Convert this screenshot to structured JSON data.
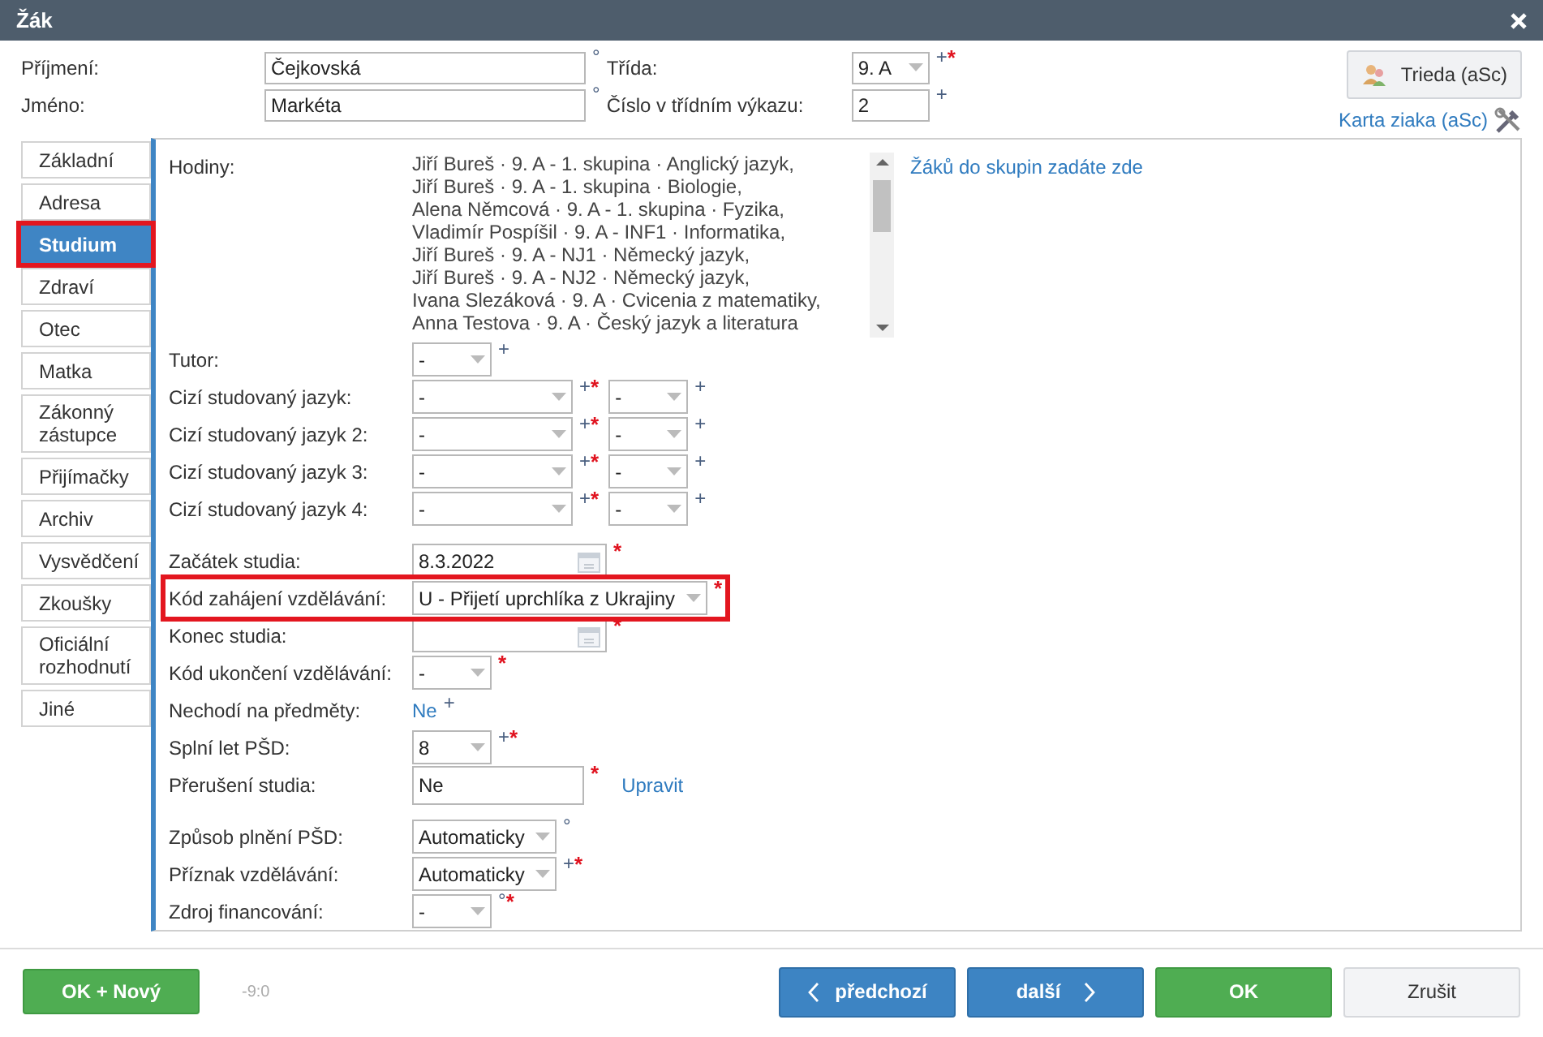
{
  "window": {
    "title": "Žák"
  },
  "header": {
    "fields": [
      {
        "label": "Příjmení:",
        "value": "Čejkovská",
        "marks": [
          {
            "text": "°",
            "kind": "hint"
          }
        ]
      },
      {
        "label": "Jméno:",
        "value": "Markéta",
        "marks": [
          {
            "text": "°",
            "kind": "hint"
          }
        ]
      }
    ],
    "class_fields": [
      {
        "label": "Třída:",
        "kind": "select",
        "value": "9. A",
        "marks": [
          {
            "text": "+",
            "kind": "hint"
          },
          {
            "text": "*",
            "kind": "required"
          }
        ]
      },
      {
        "label": "Číslo v třídním výkazu:",
        "kind": "text",
        "value": "2",
        "marks": [
          {
            "text": "+",
            "kind": "hint"
          }
        ]
      }
    ],
    "class_button": "Trieda (aSc)",
    "card_link": "Karta ziaka (aSc)"
  },
  "tabs": [
    {
      "label": "Základní",
      "selected": false,
      "highlighted": false
    },
    {
      "label": "Adresa",
      "selected": false,
      "highlighted": false
    },
    {
      "label": "Studium",
      "selected": true,
      "highlighted": true
    },
    {
      "label": "Zdraví",
      "selected": false,
      "highlighted": false
    },
    {
      "label": "Otec",
      "selected": false,
      "highlighted": false
    },
    {
      "label": "Matka",
      "selected": false,
      "highlighted": false
    },
    {
      "label": "Zákonný zástupce",
      "selected": false,
      "highlighted": false
    },
    {
      "label": "Přijímačky",
      "selected": false,
      "highlighted": false
    },
    {
      "label": "Archiv",
      "selected": false,
      "highlighted": false
    },
    {
      "label": "Vysvědčení",
      "selected": false,
      "highlighted": false
    },
    {
      "label": "Zkoušky",
      "selected": false,
      "highlighted": false
    },
    {
      "label": "Oficiální rozhodnutí",
      "selected": false,
      "highlighted": false
    },
    {
      "label": "Jiné",
      "selected": false,
      "highlighted": false
    }
  ],
  "sections": [
    [
      {
        "label": "Hodiny:",
        "kind": "list",
        "highlighted": false,
        "items": [
          "Jiří Bureš · 9. A - 1. skupina · Anglický jazyk,",
          "Jiří Bureš · 9. A - 1. skupina · Biologie,",
          "Alena Němcová · 9. A - 1. skupina · Fyzika,",
          "Vladimír Pospíšil · 9. A - INF1 · Informatika,",
          "Jiří Bureš · 9. A - NJ1 · Německý jazyk,",
          "Jiří Bureš · 9. A - NJ2 · Německý jazyk,",
          "Ivana Slezáková · 9. A · Cvicenia z matematiky,",
          "Anna Testova · 9. A · Český jazyk a literatura"
        ],
        "link": "Žáků do skupin zadáte zde"
      },
      {
        "label": "Tutor:",
        "kind": "controls",
        "highlighted": false,
        "controls": [
          {
            "kind": "short_select",
            "value": "-",
            "marks": [
              {
                "text": "+",
                "kind": "hint"
              }
            ]
          }
        ]
      },
      {
        "label": "Cizí studovaný jazyk:",
        "kind": "controls",
        "highlighted": false,
        "controls": [
          {
            "kind": "select",
            "value": "-",
            "marks": [
              {
                "text": "+",
                "kind": "hint"
              },
              {
                "text": "*",
                "kind": "required"
              }
            ]
          },
          {
            "kind": "short_select",
            "value": "-",
            "marks": [
              {
                "text": "+",
                "kind": "hint"
              }
            ]
          }
        ]
      },
      {
        "label": "Cizí studovaný jazyk 2:",
        "kind": "controls",
        "highlighted": false,
        "controls": [
          {
            "kind": "select",
            "value": "-",
            "marks": [
              {
                "text": "+",
                "kind": "hint"
              },
              {
                "text": "*",
                "kind": "required"
              }
            ]
          },
          {
            "kind": "short_select",
            "value": "-",
            "marks": [
              {
                "text": "+",
                "kind": "hint"
              }
            ]
          }
        ]
      },
      {
        "label": "Cizí studovaný jazyk 3:",
        "kind": "controls",
        "highlighted": false,
        "controls": [
          {
            "kind": "select",
            "value": "-",
            "marks": [
              {
                "text": "+",
                "kind": "hint"
              },
              {
                "text": "*",
                "kind": "required"
              }
            ]
          },
          {
            "kind": "short_select",
            "value": "-",
            "marks": [
              {
                "text": "+",
                "kind": "hint"
              }
            ]
          }
        ]
      },
      {
        "label": "Cizí studovaný jazyk 4:",
        "kind": "controls",
        "highlighted": false,
        "controls": [
          {
            "kind": "select",
            "value": "-",
            "marks": [
              {
                "text": "+",
                "kind": "hint"
              },
              {
                "text": "*",
                "kind": "required"
              }
            ]
          },
          {
            "kind": "short_select",
            "value": "-",
            "marks": [
              {
                "text": "+",
                "kind": "hint"
              }
            ]
          }
        ]
      }
    ],
    [
      {
        "label": "Začátek studia:",
        "kind": "controls",
        "highlighted": false,
        "controls": [
          {
            "kind": "date",
            "value": "8.3.2022",
            "marks": [
              {
                "text": "*",
                "kind": "required"
              }
            ]
          }
        ]
      },
      {
        "label": "Kód zahájení vzdělávání:",
        "kind": "controls",
        "highlighted": true,
        "controls": [
          {
            "kind": "wide_select",
            "value": "U - Přijetí uprchlíka z Ukrajiny",
            "marks": [
              {
                "text": "*",
                "kind": "required"
              }
            ]
          }
        ]
      },
      {
        "label": "Konec studia:",
        "kind": "controls",
        "highlighted": false,
        "controls": [
          {
            "kind": "date",
            "marks": [
              {
                "text": "*",
                "kind": "required"
              }
            ]
          }
        ]
      },
      {
        "label": "Kód ukončení vzdělávání:",
        "kind": "controls",
        "highlighted": false,
        "controls": [
          {
            "kind": "short_select",
            "value": "-",
            "marks": [
              {
                "text": "*",
                "kind": "required"
              }
            ]
          }
        ]
      },
      {
        "label": "Nechodí na předměty:",
        "kind": "controls",
        "highlighted": false,
        "controls": [
          {
            "kind": "link",
            "value": "Ne",
            "marks": [
              {
                "text": "+",
                "kind": "hint"
              }
            ]
          }
        ]
      },
      {
        "label": "Splní let PŠD:",
        "kind": "controls",
        "highlighted": false,
        "controls": [
          {
            "kind": "short_select",
            "value": "8",
            "marks": [
              {
                "text": "+",
                "kind": "hint"
              },
              {
                "text": "*",
                "kind": "required"
              }
            ]
          }
        ]
      },
      {
        "label": "Přerušení studia:",
        "kind": "controls",
        "highlighted": false,
        "controls": [
          {
            "kind": "text",
            "value": "Ne",
            "marks": [
              {
                "text": "*",
                "kind": "required"
              }
            ]
          },
          {
            "kind": "link",
            "value": "Upravit"
          }
        ]
      }
    ],
    [
      {
        "label": "Způsob plnění PŠD:",
        "kind": "controls",
        "highlighted": false,
        "controls": [
          {
            "kind": "medium_select",
            "value": "Automaticky",
            "marks": [
              {
                "text": "°",
                "kind": "hint"
              }
            ]
          }
        ]
      },
      {
        "label": "Příznak vzdělávání:",
        "kind": "controls",
        "highlighted": false,
        "controls": [
          {
            "kind": "medium_select",
            "value": "Automaticky",
            "marks": [
              {
                "text": "+",
                "kind": "hint"
              },
              {
                "text": "*",
                "kind": "required"
              }
            ]
          }
        ]
      },
      {
        "label": "Zdroj financování:",
        "kind": "controls",
        "highlighted": false,
        "controls": [
          {
            "kind": "short_select",
            "value": "-",
            "marks": [
              {
                "text": "°",
                "kind": "hint"
              },
              {
                "text": "*",
                "kind": "required"
              }
            ]
          }
        ]
      }
    ]
  ],
  "footer": {
    "ok_new": "OK + Nový",
    "counter": "-9:0",
    "previous": "předchozí",
    "next": "další",
    "ok": "OK",
    "cancel": "Zrušit"
  }
}
